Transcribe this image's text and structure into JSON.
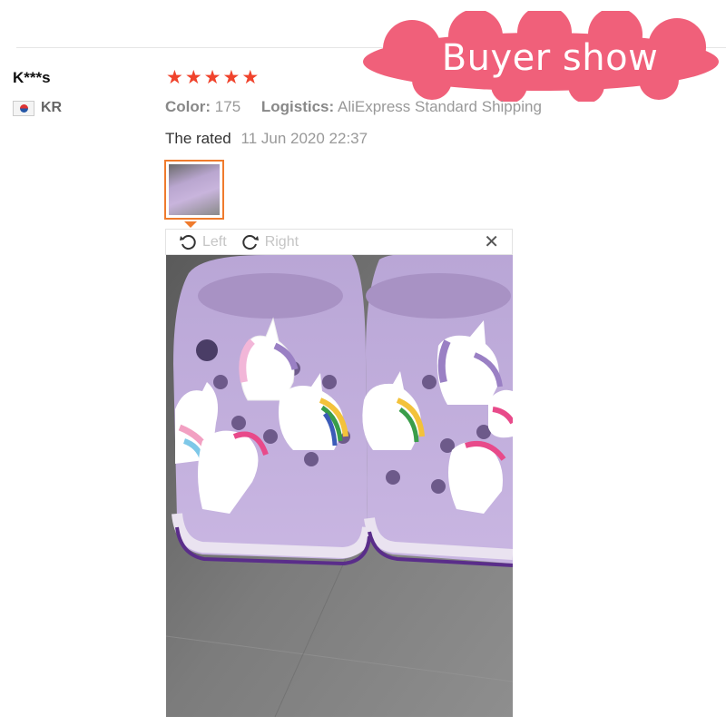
{
  "badge": {
    "text": "Buyer show",
    "color": "#f0607a"
  },
  "review": {
    "user": "K***s",
    "country_code": "KR",
    "rating": 5,
    "star_color": "#f0432c",
    "color_label": "Color:",
    "color_value": "175",
    "logistics_label": "Logistics:",
    "logistics_value": "AliExpress Standard Shipping",
    "rated_label": "The rated",
    "rated_date": "11 Jun 2020 22:37"
  },
  "viewer": {
    "left_label": "Left",
    "right_label": "Right",
    "close_icon": "close-icon",
    "rotate_left_icon": "rotate-left-icon",
    "rotate_right_icon": "rotate-right-icon"
  },
  "photo": {
    "subject": "purple-clogs-with-unicorn-charms-photo"
  }
}
